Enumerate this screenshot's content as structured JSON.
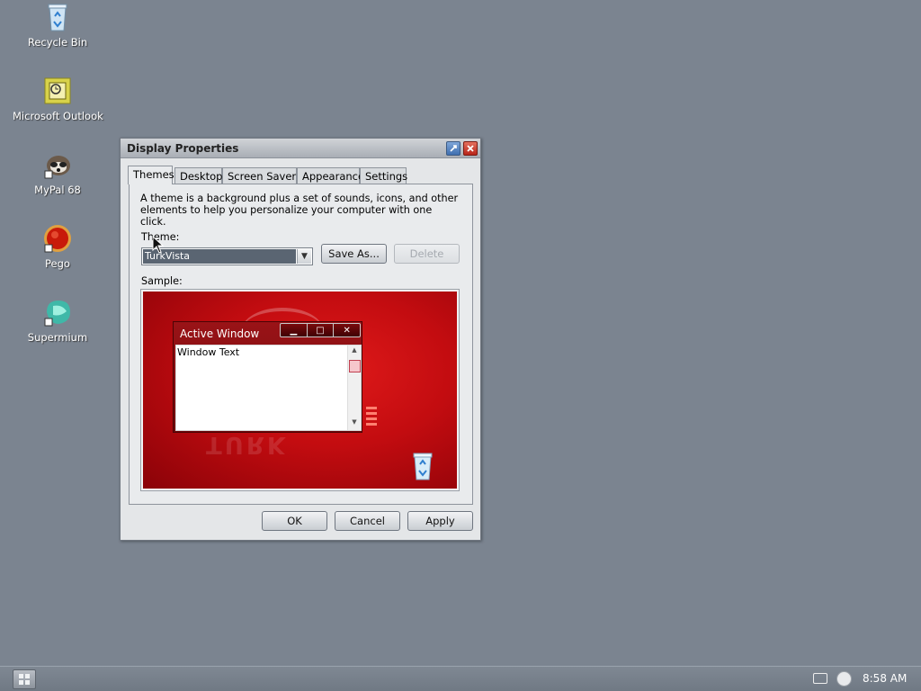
{
  "desktop": {
    "icons": [
      {
        "label": "Recycle Bin",
        "icon": "recycle-bin-icon"
      },
      {
        "label": "Microsoft Outlook",
        "icon": "outlook-icon"
      },
      {
        "label": "MyPal 68",
        "icon": "mypal-icon"
      },
      {
        "label": "Pego",
        "icon": "pego-icon"
      },
      {
        "label": "Supermium",
        "icon": "supermium-icon"
      }
    ]
  },
  "dialog": {
    "title": "Display Properties",
    "tabs": [
      {
        "label": "Themes",
        "active": true
      },
      {
        "label": "Desktop",
        "active": false
      },
      {
        "label": "Screen Saver",
        "active": false
      },
      {
        "label": "Appearance",
        "active": false
      },
      {
        "label": "Settings",
        "active": false
      }
    ],
    "description": "A theme is a background plus a set of sounds, icons, and other elements to help you personalize your computer with one click.",
    "theme_label": "Theme:",
    "theme_value": "TurkVista",
    "save_as_label": "Save As...",
    "delete_label": "Delete",
    "sample_label": "Sample:",
    "sample": {
      "window_title": "Active Window",
      "window_text": "Window Text",
      "minimize": "▁",
      "maximize": "□",
      "close": "✕"
    },
    "ok_label": "OK",
    "cancel_label": "Cancel",
    "apply_label": "Apply"
  },
  "taskbar": {
    "clock": "8:58 AM"
  },
  "colors": {
    "desktop_bg": "#7b8490",
    "sample_red": "#c30c10",
    "selection": "#5a6572"
  }
}
